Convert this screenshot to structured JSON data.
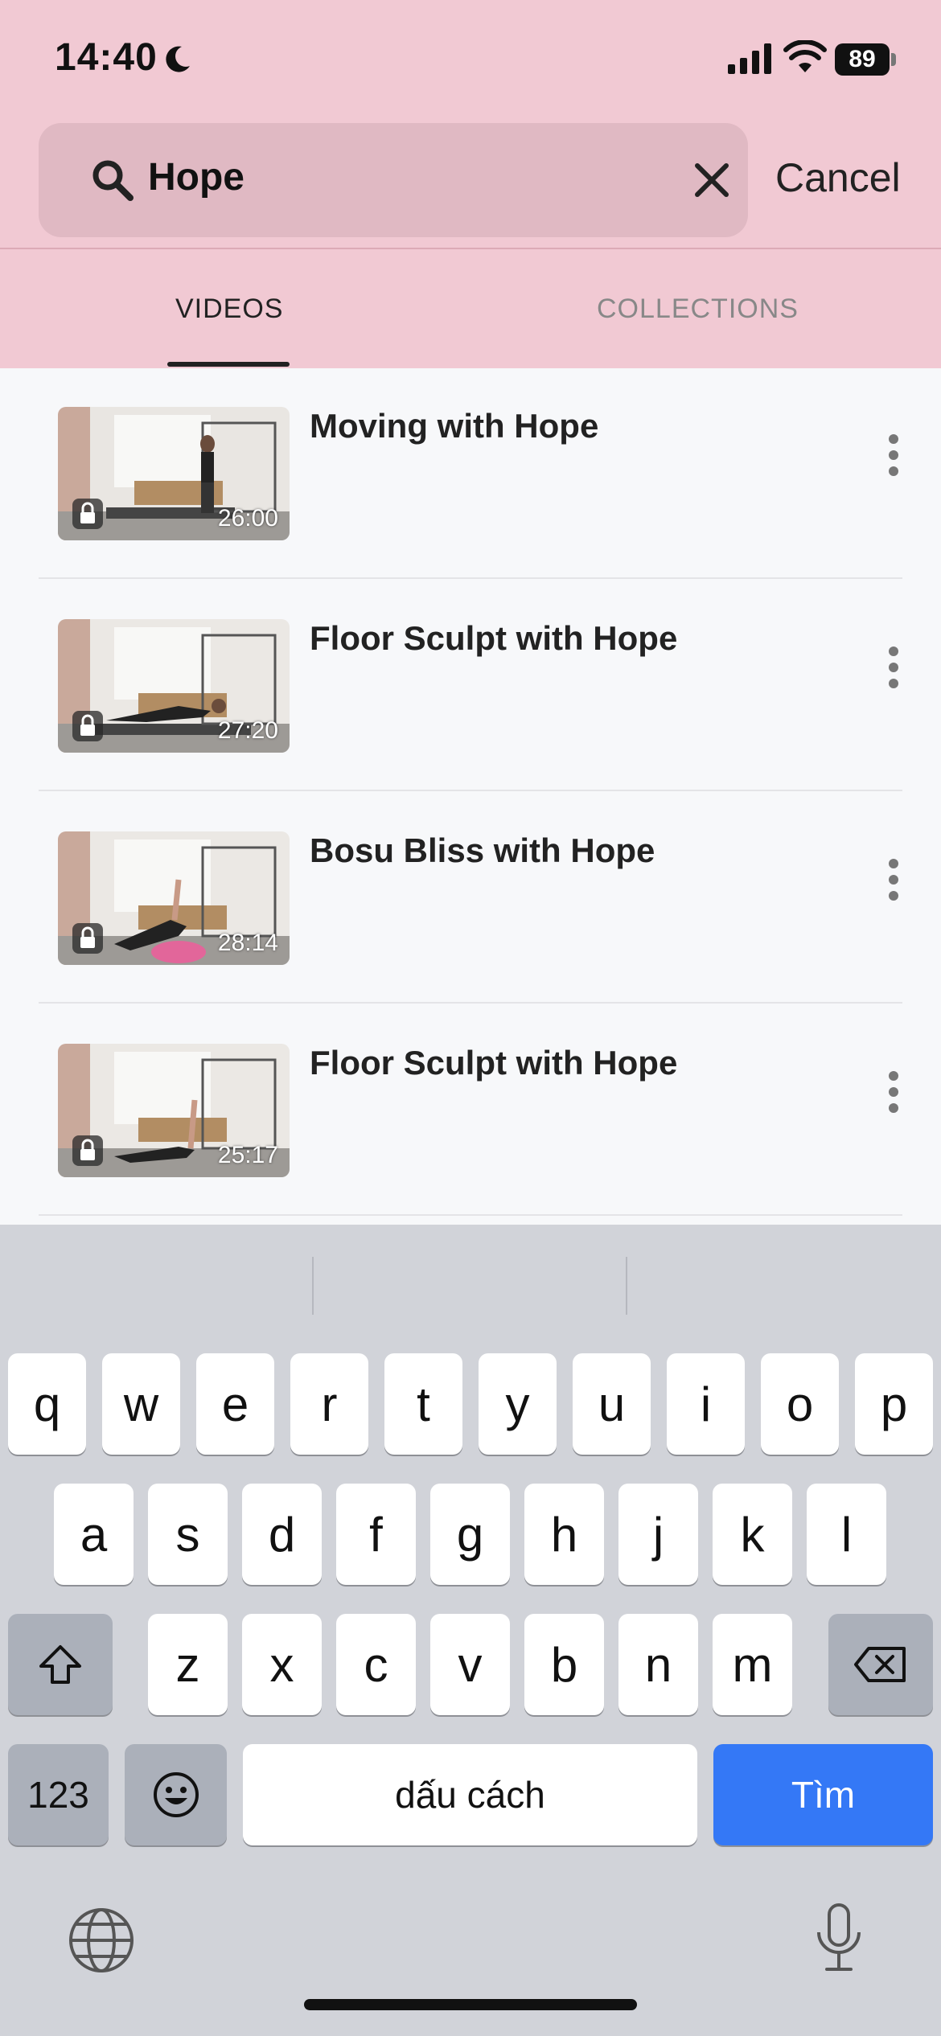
{
  "status": {
    "time": "14:40",
    "battery": "89"
  },
  "search": {
    "query": "Hope",
    "cancel_label": "Cancel"
  },
  "tabs": [
    {
      "label": "VIDEOS",
      "active": true
    },
    {
      "label": "COLLECTIONS",
      "active": false
    }
  ],
  "videos": [
    {
      "title": "Moving with Hope",
      "duration": "26:00"
    },
    {
      "title": "Floor Sculpt with Hope",
      "duration": "27:20"
    },
    {
      "title": "Bosu Bliss with Hope",
      "duration": "28:14"
    },
    {
      "title": "Floor Sculpt with Hope",
      "duration": "25:17"
    }
  ],
  "keyboard": {
    "row1": [
      "q",
      "w",
      "e",
      "r",
      "t",
      "y",
      "u",
      "i",
      "o",
      "p"
    ],
    "row2": [
      "a",
      "s",
      "d",
      "f",
      "g",
      "h",
      "j",
      "k",
      "l"
    ],
    "row3": [
      "z",
      "x",
      "c",
      "v",
      "b",
      "n",
      "m"
    ],
    "numbers_label": "123",
    "space_label": "dấu cách",
    "return_label": "Tìm"
  },
  "colors": {
    "header": "#f1c9d3",
    "accent_blue": "#3478f6"
  }
}
